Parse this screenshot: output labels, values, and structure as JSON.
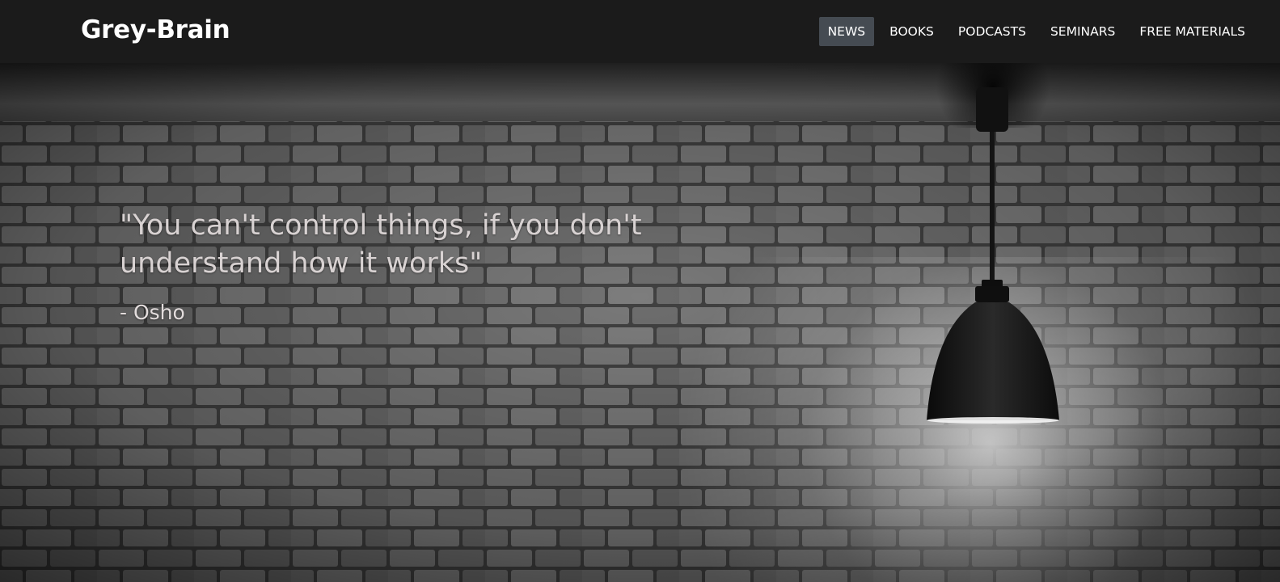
{
  "brand": {
    "name": "Grey-Brain"
  },
  "nav": {
    "items": [
      {
        "label": "NEWS",
        "active": true
      },
      {
        "label": "BOOKS",
        "active": false
      },
      {
        "label": "PODCASTS",
        "active": false
      },
      {
        "label": "SEMINARS",
        "active": false
      },
      {
        "label": "FREE MATERIALS",
        "active": false
      }
    ]
  },
  "hero": {
    "quote": "\"You can't control things, if you don't understand how it works\"",
    "author": "- Osho",
    "background": "brick-wall-with-pendant-lamp"
  },
  "colors": {
    "navbar_bg": "#1b1b1b",
    "active_nav_bg": "#454b52",
    "nav_text": "#ffffff",
    "quote_text": "#d8d2d2"
  }
}
